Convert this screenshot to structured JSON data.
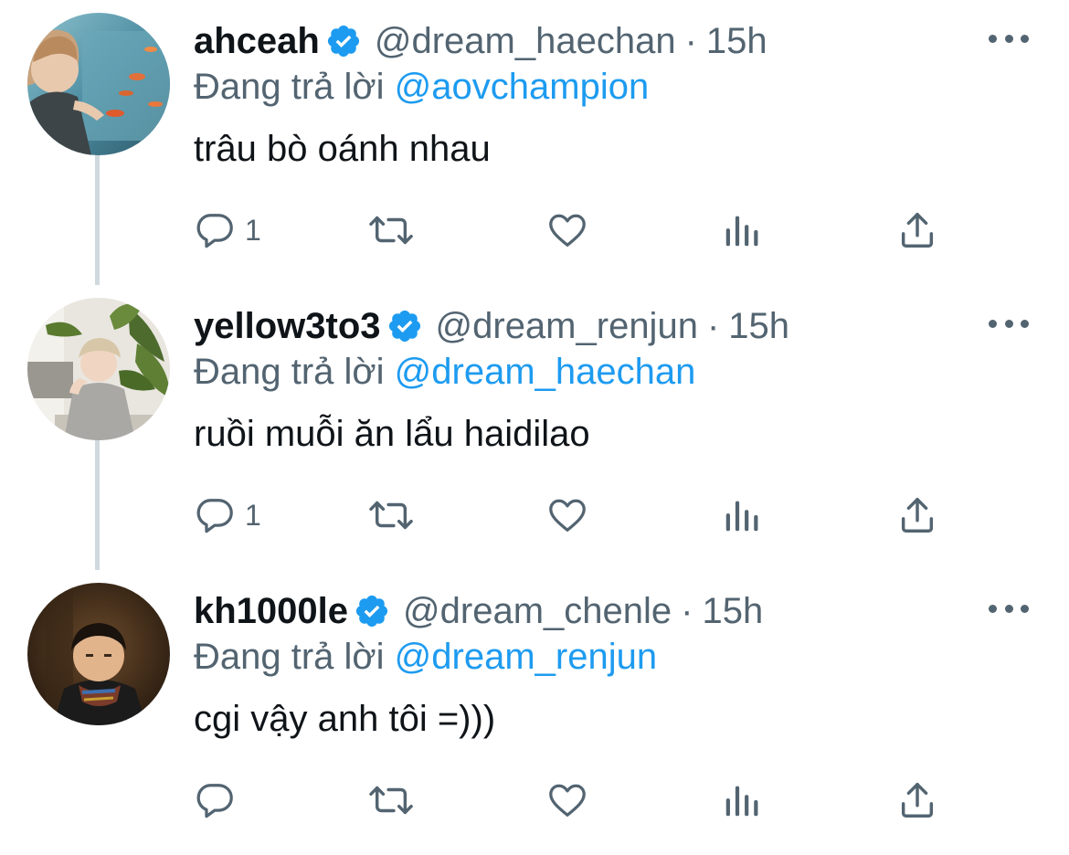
{
  "tweets": [
    {
      "display_name": "ahceah",
      "handle": "@dream_haechan",
      "separator": "·",
      "time": "15h",
      "reply_prefix": "Đang trả lời",
      "reply_to": "@aovchampion",
      "text": "trâu bò oánh nhau",
      "reply_count": "1"
    },
    {
      "display_name": "yellow3to3",
      "handle": "@dream_renjun",
      "separator": "·",
      "time": "15h",
      "reply_prefix": "Đang trả lời",
      "reply_to": "@dream_haechan",
      "text": "ruồi muỗi ăn lẩu haidilao",
      "reply_count": "1"
    },
    {
      "display_name": "kh1000le",
      "handle": "@dream_chenle",
      "separator": "·",
      "time": "15h",
      "reply_prefix": "Đang trả lời",
      "reply_to": "@dream_renjun",
      "text": "cgi vậy anh tôi =)))",
      "reply_count": ""
    }
  ],
  "colors": {
    "verified": "#1d9bf0",
    "mention": "#1d9bf0",
    "secondary_text": "#536471",
    "primary_text": "#0f1419",
    "thread_line": "#cfd9de"
  },
  "icons": {
    "verified": "verified-badge-icon",
    "more": "more-horizontal-icon",
    "reply": "reply-bubble-icon",
    "retweet": "retweet-icon",
    "like": "heart-icon",
    "views": "analytics-bars-icon",
    "share": "share-upload-icon"
  }
}
